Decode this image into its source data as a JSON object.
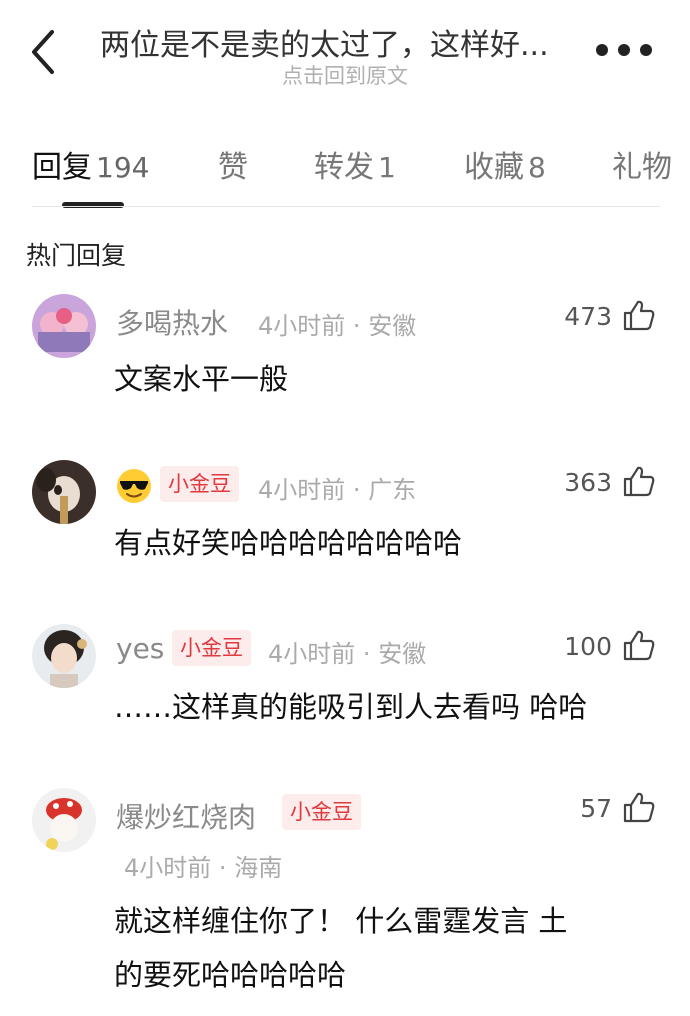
{
  "header": {
    "title": "两位是不是卖的太过了，这样好...",
    "subtitle": "点击回到原文"
  },
  "tabs": [
    {
      "label": "回复",
      "count": "194",
      "active": true
    },
    {
      "label": "赞",
      "count": "",
      "active": false
    },
    {
      "label": "转发",
      "count": "1",
      "active": false
    },
    {
      "label": "收藏",
      "count": "8",
      "active": false
    },
    {
      "label": "礼物",
      "count": "",
      "active": false
    }
  ],
  "section_title": "热门回复",
  "comments": [
    {
      "user": "多喝热水",
      "badge": "",
      "time": "4小时前",
      "location": "安徽",
      "likes": "473",
      "text": [
        "文案水平一般"
      ]
    },
    {
      "user": "",
      "emoji": "sunglasses-emoji",
      "badge": "小金豆",
      "time": "4小时前",
      "location": "广东",
      "likes": "363",
      "text": [
        "有点好笑哈哈哈哈哈哈哈哈"
      ]
    },
    {
      "user": "yes",
      "badge": "小金豆",
      "time": "4小时前",
      "location": "安徽",
      "likes": "100",
      "text": [
        "……这样真的能吸引到人去看吗 哈哈"
      ]
    },
    {
      "user": "爆炒红烧肉",
      "badge": "小金豆",
      "time": "4小时前",
      "location": "海南",
      "likes": "57",
      "text": [
        "就这样缠住你了！ 什么雷霆发言 土",
        "的要死哈哈哈哈哈"
      ]
    }
  ],
  "meta_separator": "·"
}
